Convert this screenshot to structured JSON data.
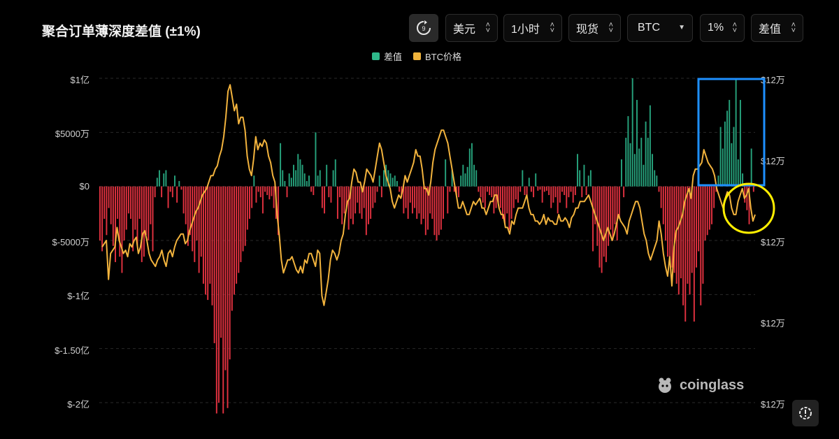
{
  "title": "聚合订单薄深度差值 (±1%)",
  "controls": {
    "currency": "美元",
    "interval": "1小时",
    "market": "现货",
    "symbol": "BTC",
    "depth": "1%",
    "mode": "差值"
  },
  "legend": [
    {
      "label": "差值",
      "color": "#2eb88a"
    },
    {
      "label": "BTC价格",
      "color": "#f0b43c"
    }
  ],
  "watermark": "coinglass",
  "colors": {
    "positive": "#26a17b",
    "negative": "#e0313f",
    "price": "#f2b33d",
    "annotation_box": "#1e90ff",
    "annotation_circle": "#ffee00"
  },
  "chart_data": {
    "type": "bar",
    "left_axis_ticks": [
      "$1亿",
      "$5000万",
      "$0",
      "$-5000万",
      "$-1亿",
      "$-1.50亿",
      "$-2亿"
    ],
    "right_axis_ticks": [
      "$12万",
      "$12万",
      "$12万",
      "$12万",
      "$12万"
    ],
    "ylim": [
      -20000,
      10000
    ],
    "series": [
      {
        "name": "差值",
        "values": [
          -5000,
          -6000,
          -3000,
          -4500,
          -2000,
          -3500,
          -5500,
          -7000,
          -3000,
          -6500,
          -8000,
          -5000,
          -4000,
          -2500,
          -3000,
          -6000,
          -4000,
          -5500,
          -3000,
          -7000,
          -6500,
          -4500,
          -5000,
          -3500,
          -6000,
          -1000,
          800,
          1500,
          -1000,
          1200,
          1500,
          -2000,
          -500,
          -1000,
          1000,
          -1500,
          500,
          -300,
          -2500,
          -3500,
          -5500,
          -4500,
          -6000,
          -7000,
          -5000,
          -8000,
          -6500,
          -9000,
          -10000,
          -10500,
          -9000,
          -11000,
          -14500,
          -21000,
          -20000,
          -14000,
          -21000,
          -17000,
          -20500,
          -16000,
          -11500,
          -10000,
          -9000,
          -8000,
          -7000,
          -6000,
          -5500,
          -4000,
          -3000,
          -2000,
          1000,
          -1500,
          -500,
          -1000,
          -2500,
          -500,
          -800,
          -1200,
          -900,
          -2000,
          -3000,
          -4500,
          4000,
          1500,
          500,
          -1000,
          1200,
          800,
          2000,
          1500,
          3000,
          2500,
          2000,
          1200,
          500,
          1000,
          -500,
          -800,
          5000,
          1000,
          1500,
          -2000,
          -2500,
          2000,
          -1000,
          -1500,
          1500,
          2500,
          -3000,
          -1000,
          -3500,
          -2500,
          -2000,
          -4000,
          -3000,
          -3500,
          -2500,
          -1500,
          -2500,
          -3000,
          -2000,
          -4500,
          -3500,
          -3000,
          -2000,
          -1500,
          -500,
          1000,
          -1000,
          1500,
          2000,
          1500,
          1200,
          800,
          1000,
          500,
          -500,
          -1000,
          -2500,
          -2000,
          -3000,
          -1500,
          -2500,
          -2000,
          -3000,
          -2500,
          -3500,
          -3000,
          -4500,
          -4000,
          -2500,
          -3000,
          -4500,
          -5000,
          -4500,
          -4000,
          -3000,
          2500,
          -2500,
          -500,
          1500,
          -500,
          -800,
          -1000,
          1000,
          2000,
          1200,
          1800,
          3500,
          4000,
          2000,
          1500,
          -500,
          -1000,
          -1500,
          -2000,
          -500,
          -800,
          -1000,
          -2500,
          -2000,
          -1500,
          -2000,
          -3000,
          -3500,
          -2500,
          -4000,
          -3000,
          -2000,
          -1200,
          -1500,
          -500,
          1500,
          -800,
          -1000,
          800,
          -500,
          -1000,
          1200,
          -400,
          -300,
          -1500,
          -500,
          -400,
          -800,
          -2000,
          -1500,
          -1000,
          -2500,
          -1500,
          -500,
          -800,
          -2000,
          -1000,
          -500,
          -1500,
          -800,
          3000,
          1500,
          -1000,
          2000,
          -800,
          1000,
          1500,
          -6000,
          -3500,
          -5500,
          -7500,
          -8000,
          -6500,
          -7000,
          -5500,
          -4000,
          -5000,
          -3500,
          -5000,
          -3000,
          2500,
          -1000,
          4500,
          6500,
          4000,
          10000,
          3000,
          8000,
          3500,
          4500,
          2000,
          6000,
          4500,
          7500,
          3000,
          1500,
          1000,
          -500,
          -2000,
          -3500,
          -5000,
          -6500,
          -7000,
          -7500,
          -8000,
          -9000,
          -10000,
          -8500,
          -11000,
          -12500,
          -9000,
          -10000,
          -8000,
          -12500,
          -7500,
          -6000,
          -11000,
          -9000,
          -5000,
          -4500,
          -4000,
          -3500,
          -2000,
          -500,
          1000,
          5500,
          3500,
          6000,
          7000,
          8000,
          4000,
          5500,
          10000,
          2500,
          8000,
          1200,
          -1500,
          -2200,
          -3500,
          3500,
          -500
        ]
      },
      {
        "name": "BTC价格",
        "values": [
          48,
          49,
          50,
          38,
          46,
          47,
          48,
          54,
          50,
          48,
          46,
          47,
          45,
          49,
          48,
          50,
          51,
          46,
          48,
          52,
          53,
          50,
          46,
          44,
          43,
          42,
          44,
          45,
          47,
          44,
          42,
          46,
          47,
          45,
          48,
          50,
          51,
          52,
          52,
          49,
          50,
          53,
          55,
          57,
          59,
          60,
          62,
          64,
          65,
          66,
          68,
          70,
          70,
          72,
          73,
          76,
          78,
          82,
          88,
          96,
          98,
          94,
          90,
          92,
          86,
          88,
          88,
          84,
          76,
          72,
          70,
          75,
          82,
          78,
          80,
          79,
          81,
          80,
          76,
          74,
          70,
          68,
          58,
          52,
          44,
          40,
          42,
          44,
          44,
          45,
          43,
          41,
          40,
          42,
          40,
          44,
          43,
          46,
          46,
          44,
          42,
          47,
          46,
          33,
          30,
          34,
          38,
          44,
          47,
          46,
          44,
          46,
          50,
          52,
          58,
          62,
          63,
          68,
          72,
          71,
          68,
          68,
          65,
          68,
          72,
          71,
          70,
          68,
          72,
          76,
          80,
          78,
          74,
          70,
          68,
          66,
          62,
          60,
          62,
          64,
          63,
          66,
          70,
          68,
          70,
          72,
          74,
          78,
          76,
          76,
          72,
          66,
          66,
          64,
          68,
          74,
          78,
          80,
          82,
          84,
          84,
          82,
          80,
          76,
          72,
          68,
          64,
          60,
          60,
          62,
          60,
          58,
          58,
          60,
          62,
          61,
          62,
          63,
          60,
          60,
          58,
          60,
          62,
          62,
          64,
          64,
          60,
          58,
          58,
          54,
          54,
          52,
          56,
          55,
          58,
          60,
          60,
          60,
          62,
          64,
          60,
          58,
          58,
          56,
          56,
          55,
          56,
          58,
          55,
          57,
          56,
          56,
          55,
          55,
          58,
          56,
          56,
          57,
          56,
          54,
          57,
          58,
          60,
          60,
          62,
          62,
          62,
          63,
          64,
          62,
          60,
          58,
          56,
          54,
          52,
          50,
          52,
          54,
          52,
          50,
          52,
          55,
          58,
          56,
          55,
          54,
          52,
          56,
          58,
          60,
          62,
          62,
          60,
          56,
          52,
          50,
          46,
          44,
          46,
          48,
          50,
          56,
          52,
          46,
          42,
          39,
          45,
          36,
          48,
          53,
          54,
          56,
          58,
          62,
          64,
          66,
          63,
          70,
          72,
          72,
          73,
          74,
          78,
          76,
          74,
          73,
          72,
          70,
          66,
          64,
          62,
          60,
          63,
          65,
          64,
          60,
          58,
          58,
          62,
          64,
          66,
          63,
          64,
          66,
          60,
          56,
          58
        ]
      }
    ]
  }
}
